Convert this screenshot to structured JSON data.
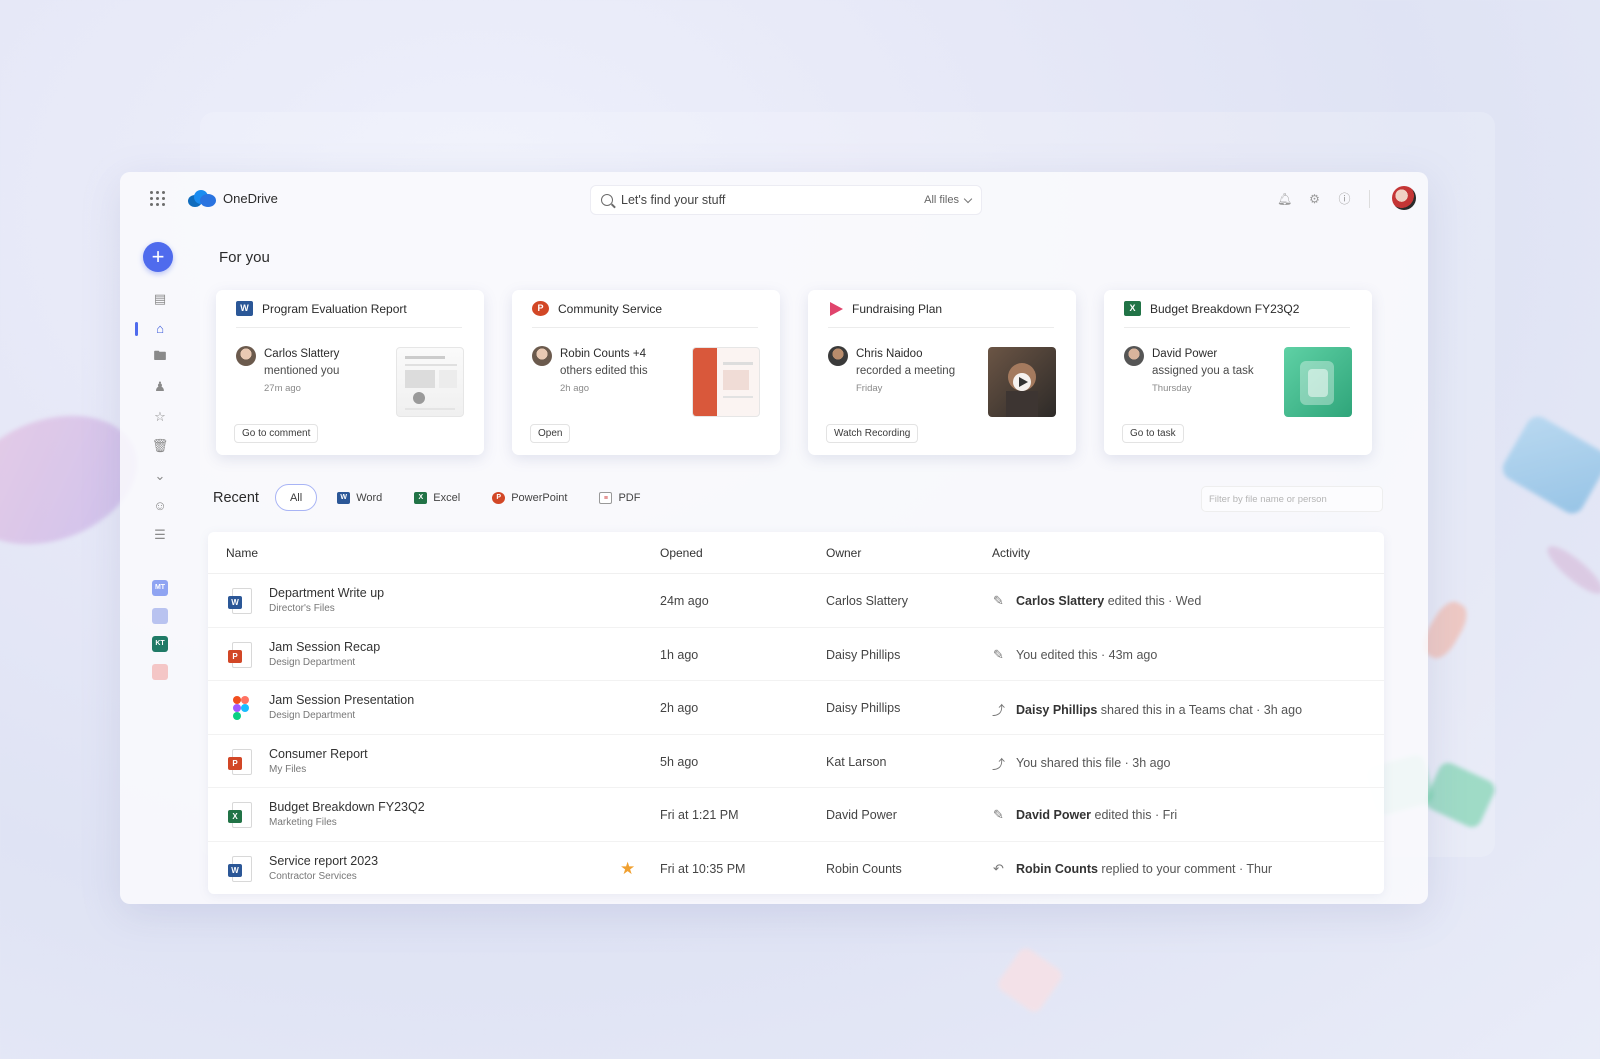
{
  "app": {
    "name": "OneDrive"
  },
  "search": {
    "placeholder": "Let's find your stuff",
    "scope": "All files"
  },
  "for_you": {
    "title": "For you",
    "cards": [
      {
        "title": "Program Evaluation Report",
        "app": "Word",
        "person": "Carlos Slattery",
        "action_text": "mentioned you",
        "time": "27m ago",
        "button": "Go to comment"
      },
      {
        "title": "Community Service",
        "app": "PowerPoint",
        "person": "Robin Counts +4",
        "action_text": "others edited this",
        "time": "2h ago",
        "button": "Open"
      },
      {
        "title": "Fundraising Plan",
        "app": "Stream",
        "person": "Chris Naidoo",
        "action_text": "recorded a meeting",
        "time": "Friday",
        "button": "Watch Recording"
      },
      {
        "title": "Budget Breakdown FY23Q2",
        "app": "Excel",
        "person": "David Power",
        "action_text": "assigned you a task",
        "time": "Thursday",
        "button": "Go to task"
      }
    ]
  },
  "recent": {
    "title": "Recent",
    "filters": [
      "All",
      "Word",
      "Excel",
      "PowerPoint",
      "PDF"
    ],
    "filter_placeholder": "Filter by file name or person",
    "columns": [
      "Name",
      "Opened",
      "Owner",
      "Activity"
    ],
    "rows": [
      {
        "name": "Department Write up",
        "location": "Director's Files",
        "type": "word",
        "opened": "24m ago",
        "owner": "Carlos Slattery",
        "activity_person": "Carlos Slattery",
        "activity": "edited this · Wed",
        "activity_icon": "edit-icon"
      },
      {
        "name": "Jam Session Recap",
        "location": "Design Department",
        "type": "powerpoint",
        "opened": "1h ago",
        "owner": "Daisy Phillips",
        "activity_person": "",
        "activity": "You edited this · 43m ago",
        "activity_icon": "edit-icon"
      },
      {
        "name": "Jam Session Presentation",
        "location": "Design Department",
        "type": "figma",
        "opened": "2h ago",
        "owner": "Daisy Phillips",
        "activity_person": "Daisy Phillips",
        "activity": "shared this in a Teams chat · 3h ago",
        "activity_icon": "share-icon"
      },
      {
        "name": "Consumer Report",
        "location": "My Files",
        "type": "powerpoint",
        "opened": "5h ago",
        "owner": "Kat Larson",
        "activity_person": "",
        "activity": "You shared this file · 3h ago",
        "activity_icon": "share-icon"
      },
      {
        "name": "Budget Breakdown FY23Q2",
        "location": "Marketing Files",
        "type": "excel",
        "opened": "Fri at 1:21 PM",
        "owner": "David Power",
        "activity_person": "David Power",
        "activity": "edited this · Fri",
        "activity_icon": "edit-icon"
      },
      {
        "name": "Service report 2023",
        "location": "Contractor Services",
        "type": "word",
        "opened": "Fri at 10:35 PM",
        "owner": "Robin Counts",
        "activity_person": "Robin Counts",
        "activity": "replied to your comment · Thur",
        "activity_icon": "reply-icon",
        "starred": true
      }
    ]
  },
  "colors": {
    "accent": "#4f6bed",
    "word": "#2b5797",
    "excel": "#217346",
    "powerpoint": "#d24726",
    "star": "#f0a030"
  }
}
